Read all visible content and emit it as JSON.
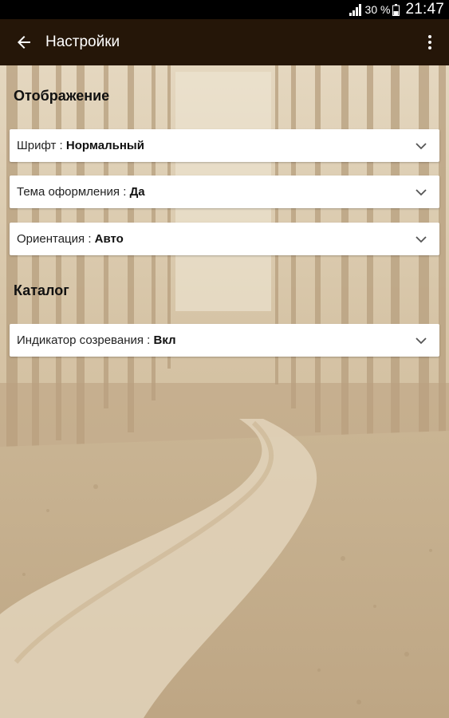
{
  "status_bar": {
    "battery_percent": "30 %",
    "time": "21:47",
    "icons": [
      "signal-icon",
      "battery-icon"
    ]
  },
  "toolbar": {
    "title": "Настройки",
    "back_icon": "back-arrow-icon",
    "menu_icon": "overflow-menu-icon",
    "background_color": "#251608"
  },
  "sections": [
    {
      "title": "Отображение",
      "items": [
        {
          "label": "Шрифт",
          "separator": " : ",
          "value": "Нормальный"
        },
        {
          "label": "Тема оформления",
          "separator": " : ",
          "value": "Да"
        },
        {
          "label": "Ориентация",
          "separator": " : ",
          "value": "Авто"
        }
      ]
    },
    {
      "title": "Каталог",
      "items": [
        {
          "label": "Индикатор созревания",
          "separator": " : ",
          "value": "Вкл"
        }
      ]
    }
  ],
  "colors": {
    "background_tint": "#d9c8ad",
    "card": "#ffffff",
    "text": "#111111"
  }
}
